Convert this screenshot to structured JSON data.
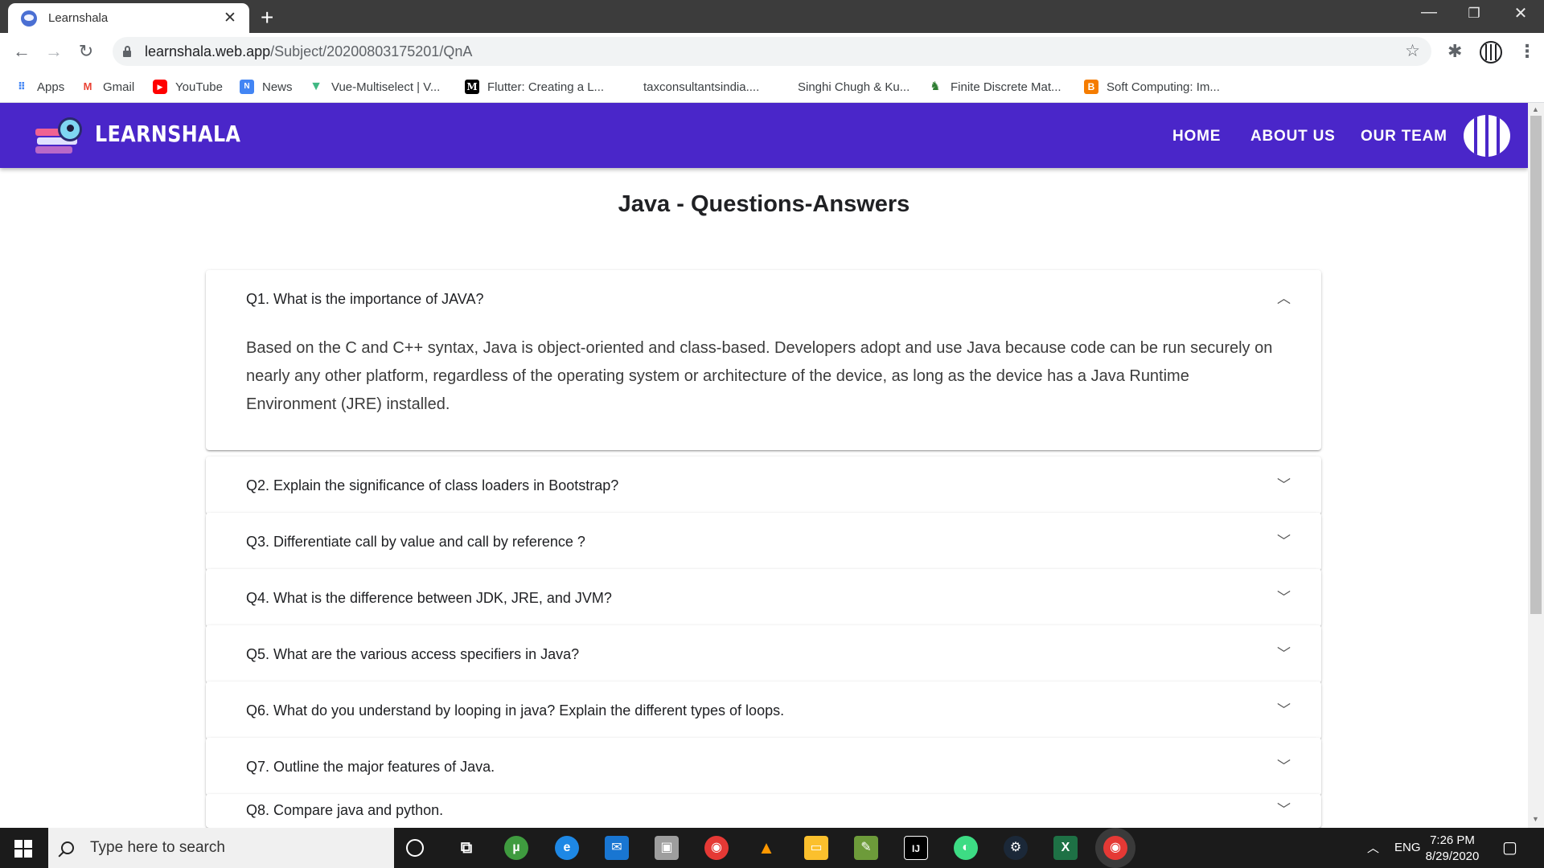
{
  "browser": {
    "tab_title": "Learnshala",
    "tab_close": "✕",
    "new_tab": "+",
    "url_host": "learnshala.web.app",
    "url_path": "/Subject/20200803175201/QnA"
  },
  "bookmarks": [
    {
      "label": "Apps",
      "icon": "apps-grid-icon",
      "color": "#4285f4"
    },
    {
      "label": "Gmail",
      "icon": "gmail-icon",
      "color": "#ea4335"
    },
    {
      "label": "YouTube",
      "icon": "youtube-icon",
      "color": "#ff0000"
    },
    {
      "label": "News",
      "icon": "google-news-icon",
      "color": "#4285f4"
    },
    {
      "label": "Vue-Multiselect | V...",
      "icon": "vue-icon",
      "color": "#41b883"
    },
    {
      "label": "Flutter: Creating a L...",
      "icon": "medium-icon",
      "color": "#000000"
    },
    {
      "label": "taxconsultantsindia....",
      "icon": "",
      "color": ""
    },
    {
      "label": "Singhi Chugh & Ku...",
      "icon": "",
      "color": ""
    },
    {
      "label": "Finite Discrete Mat...",
      "icon": "finite-math-icon",
      "color": "#2e7d32"
    },
    {
      "label": "Soft Computing: Im...",
      "icon": "blogger-icon",
      "color": "#f57c00"
    }
  ],
  "site": {
    "brand": "LEARNSHALA",
    "nav": [
      "HOME",
      "ABOUT US",
      "OUR TEAM"
    ],
    "brand_color": "#4a26c9"
  },
  "page": {
    "title": "Java - Questions-Answers"
  },
  "qna": [
    {
      "question": "Q1. What is the importance of JAVA?",
      "expanded": true,
      "answer": "Based on the C and C++ syntax, Java is object-oriented and class-based. Developers adopt and use Java because code can be run securely on nearly any other platform, regardless of the operating system or architecture of the device, as long as the device has a Java Runtime Environment (JRE) installed."
    },
    {
      "question": "Q2. Explain the significance of class loaders in Bootstrap?",
      "expanded": false
    },
    {
      "question": "Q3. Differentiate call by value and call by reference ?",
      "expanded": false
    },
    {
      "question": "Q4. What is the difference between JDK, JRE, and JVM?",
      "expanded": false
    },
    {
      "question": "Q5. What are the various access specifiers in Java?",
      "expanded": false
    },
    {
      "question": "Q6. What do you understand by looping in java? Explain the different types of loops.",
      "expanded": false
    },
    {
      "question": "Q7. Outline the major features of Java.",
      "expanded": false
    },
    {
      "question": "Q8. Compare java and python.",
      "expanded": false
    }
  ],
  "taskbar": {
    "search_placeholder": "Type here to search",
    "language": "ENG",
    "time": "7:26 PM",
    "date": "8/29/2020"
  }
}
